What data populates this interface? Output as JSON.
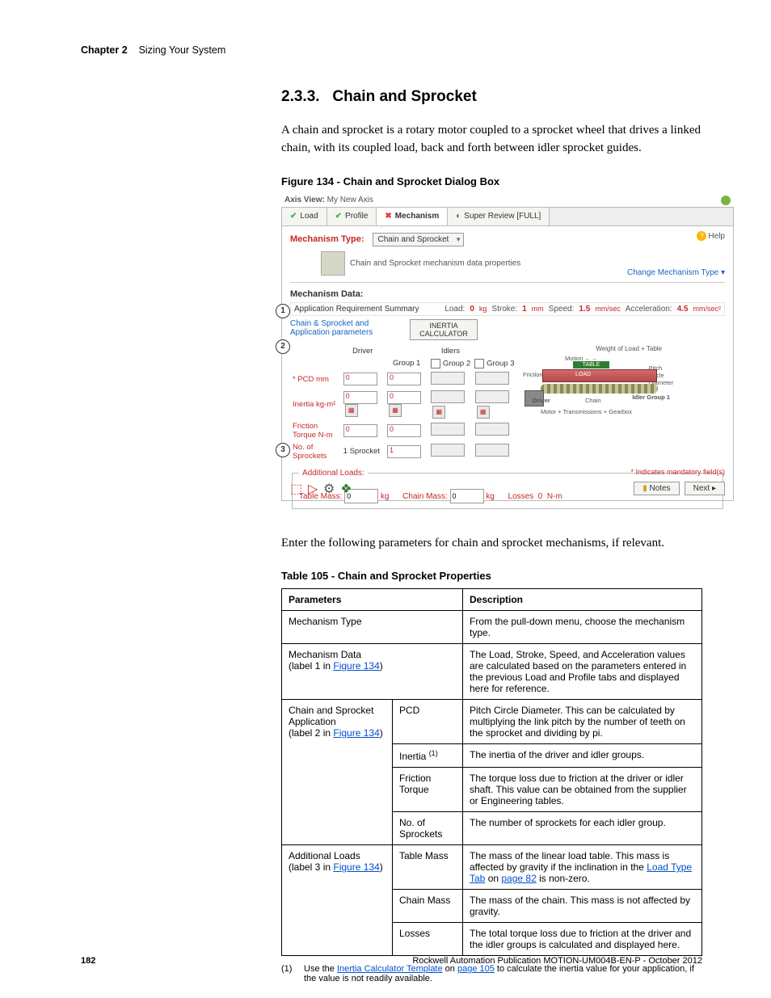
{
  "header": {
    "chapter": "Chapter 2",
    "title": "Sizing Your System"
  },
  "section": {
    "number": "2.3.3.",
    "title": "Chain and Sprocket"
  },
  "intro": "A chain and sprocket is a rotary motor coupled to a sprocket wheel that drives a linked chain, with its coupled load, back and forth between idler sprocket guides.",
  "figure_caption": "Figure 134 - Chain and Sprocket Dialog Box",
  "screenshot": {
    "axis_view_label": "Axis View:",
    "axis_view_value": "My New Axis",
    "tabs": {
      "load": "Load",
      "profile": "Profile",
      "mechanism": "Mechanism",
      "super": "Super Review [FULL]"
    },
    "mech_type_label": "Mechanism Type:",
    "mech_type_value": "Chain and Sprocket",
    "help": "Help",
    "subhead": "Chain and Sprocket mechanism data properties",
    "change_link": "Change Mechanism Type ▾",
    "mech_data_label": "Mechanism Data:",
    "summary_label": "Application Requirement Summary",
    "summary": {
      "load_l": "Load:",
      "load_v": "0",
      "load_u": "kg",
      "stroke_l": "Stroke:",
      "stroke_v": "1",
      "stroke_u": "mm",
      "speed_l": "Speed:",
      "speed_v": "1.5",
      "speed_u": "mm/sec",
      "accel_l": "Acceleration:",
      "accel_v": "4.5",
      "accel_u": "mm/sec²"
    },
    "inertia_btn_l1": "INERTIA",
    "inertia_btn_l2": "CALCULATOR",
    "sub_link": "Chain & Sprocket and Application parameters",
    "cols": {
      "driver": "Driver",
      "idlers": "Idlers",
      "g1": "Group 1",
      "g2": "Group 2",
      "g3": "Group 3"
    },
    "rows": {
      "pcd": "* PCD  mm",
      "inertia": "Inertia  kg-m²",
      "ft": "Friction Torque  N-m",
      "nspr": "No. of Sprockets"
    },
    "vals": {
      "zero": "0",
      "one": "1",
      "one_spr": "1 Sprocket"
    },
    "diagram": {
      "title": "Weight of Load + Table",
      "motion": "Motion ←→",
      "fric": "Friction Surface",
      "load": "LOAD",
      "table": "TABLE",
      "pcd": "Pitch\nCircle\nDiameter",
      "driver": "Driver",
      "chain": "Chain",
      "idler": "Idler Group 1",
      "bottom": "Motor + Transmissions + Gearbox"
    },
    "addl": {
      "legend": "Additional Loads:",
      "table_mass": "Table Mass:",
      "table_mass_v": "0",
      "chain_mass": "Chain Mass:",
      "chain_mass_v": "0",
      "kg": "kg",
      "losses_l": "Losses",
      "losses_v": "0",
      "losses_u": "N-m"
    },
    "mand": "* Indicates mandatory field(s)",
    "notes_btn": "Notes",
    "next_btn": "Next ▸"
  },
  "after_fig": "Enter the following parameters for chain and sprocket mechanisms, if relevant.",
  "table_caption": "Table 105 - Chain and Sprocket Properties",
  "table": {
    "head_param": "Parameters",
    "head_desc": "Description",
    "r1_p": "Mechanism Type",
    "r1_d": "From the pull-down menu, choose the mechanism type.",
    "r2_p_a": "Mechanism Data",
    "r2_p_b_pre": "(label 1 in ",
    "r2_p_b_link": "Figure 134",
    "r2_p_b_post": ")",
    "r2_d": "The Load, Stroke, Speed, and Acceleration values are calculated based on the parameters entered in the previous Load and Profile tabs and displayed here for reference.",
    "r3_p_a": "Chain and Sprocket Application",
    "r3_p_b_pre": "(label 2 in ",
    "r3_p_b_link": "Figure 134",
    "r3_p_b_post": ")",
    "r3_sub1_p": "PCD",
    "r3_sub1_d": "Pitch Circle Diameter. This can be calculated by multiplying the link pitch by the number of teeth on the sprocket and dividing by pi.",
    "r3_sub2_p": "Inertia ",
    "r3_sub2_sup": "(1)",
    "r3_sub2_d": "The inertia of the driver and idler groups.",
    "r3_sub3_p": "Friction Torque",
    "r3_sub3_d": "The torque loss due to friction at the driver or idler shaft. This value can be obtained from the supplier or Engineering tables.",
    "r3_sub4_p": "No. of Sprockets",
    "r3_sub4_d": "The number of sprockets for each idler group.",
    "r4_p_a": "Additional Loads",
    "r4_p_b_pre": "(label 3 in ",
    "r4_p_b_link": "Figure 134",
    "r4_p_b_post": ")",
    "r4_sub1_p": "Table Mass",
    "r4_sub1_d_a": "The mass of the linear load table. This mass is affected by gravity if the inclination in the ",
    "r4_sub1_d_link": "Load Type Tab",
    "r4_sub1_d_b": " on ",
    "r4_sub1_d_link2": "page 82",
    "r4_sub1_d_c": " is non-zero.",
    "r4_sub2_p": "Chain Mass",
    "r4_sub2_d": "The mass of the chain. This mass is not affected by gravity.",
    "r4_sub3_p": "Losses",
    "r4_sub3_d": "The total torque loss due to friction at the driver and the idler groups is calculated and displayed here."
  },
  "footnote": {
    "num": "(1)",
    "a": "Use the ",
    "link1": "Inertia Calculator Template",
    "b": " on ",
    "link2": "page 105",
    "c": " to calculate the inertia value for your application, if the value is not readily available."
  },
  "footer": {
    "page": "182",
    "pub": "Rockwell Automation Publication MOTION-UM004B-EN-P - October 2012"
  }
}
